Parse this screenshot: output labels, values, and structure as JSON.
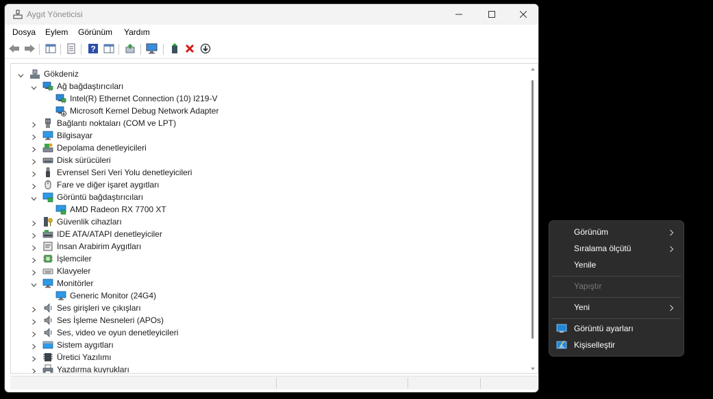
{
  "window": {
    "title": "Aygıt Yöneticisi",
    "controls": [
      "minimize-icon",
      "maximize-icon",
      "close-icon"
    ]
  },
  "menu": [
    "Dosya",
    "Eylem",
    "Görünüm",
    "Yardım"
  ],
  "toolbar_icons": [
    "back-arrow-icon",
    "forward-arrow-icon",
    "show-hide-console-tree-icon",
    "properties-icon",
    "help-icon",
    "show-action-pane-icon",
    "update-driver-icon",
    "scan-hardware-changes-icon",
    "enable-device-icon",
    "uninstall-device-icon",
    "disable-device-icon"
  ],
  "tree": {
    "root": "Gökdeniz",
    "items": [
      {
        "label": "Gökdeniz",
        "level": 0,
        "state": "expanded",
        "icon": "computer-root-icon"
      },
      {
        "label": "Ağ bağdaştırıcıları",
        "level": 1,
        "state": "expanded",
        "icon": "network-adapter-icon"
      },
      {
        "label": "Intel(R) Ethernet Connection (10) I219-V",
        "level": 2,
        "state": "leaf",
        "icon": "network-adapter-icon"
      },
      {
        "label": "Microsoft Kernel Debug Network Adapter",
        "level": 2,
        "state": "leaf",
        "icon": "network-adapter-disabled-icon"
      },
      {
        "label": "Bağlantı noktaları (COM ve LPT)",
        "level": 1,
        "state": "collapsed",
        "icon": "port-icon"
      },
      {
        "label": "Bilgisayar",
        "level": 1,
        "state": "collapsed",
        "icon": "monitor-icon"
      },
      {
        "label": "Depolama denetleyicileri",
        "level": 1,
        "state": "collapsed",
        "icon": "storage-controller-icon"
      },
      {
        "label": "Disk sürücüleri",
        "level": 1,
        "state": "collapsed",
        "icon": "disk-drive-icon"
      },
      {
        "label": "Evrensel Seri Veri Yolu denetleyicileri",
        "level": 1,
        "state": "collapsed",
        "icon": "usb-icon"
      },
      {
        "label": "Fare ve diğer işaret aygıtları",
        "level": 1,
        "state": "collapsed",
        "icon": "mouse-icon"
      },
      {
        "label": "Görüntü bağdaştırıcıları",
        "level": 1,
        "state": "expanded",
        "icon": "display-adapter-icon"
      },
      {
        "label": "AMD Radeon RX 7700 XT",
        "level": 2,
        "state": "leaf",
        "icon": "display-adapter-icon"
      },
      {
        "label": "Güvenlik cihazları",
        "level": 1,
        "state": "collapsed",
        "icon": "security-device-icon"
      },
      {
        "label": "IDE ATA/ATAPI denetleyiciler",
        "level": 1,
        "state": "collapsed",
        "icon": "ide-controller-icon"
      },
      {
        "label": "İnsan Arabirim Aygıtları",
        "level": 1,
        "state": "collapsed",
        "icon": "hid-icon"
      },
      {
        "label": "İşlemciler",
        "level": 1,
        "state": "collapsed",
        "icon": "processor-icon"
      },
      {
        "label": "Klavyeler",
        "level": 1,
        "state": "collapsed",
        "icon": "keyboard-icon"
      },
      {
        "label": "Monitörler",
        "level": 1,
        "state": "expanded",
        "icon": "monitor-icon"
      },
      {
        "label": "Generic Monitor (24G4)",
        "level": 2,
        "state": "leaf",
        "icon": "monitor-icon"
      },
      {
        "label": "Ses girişleri ve çıkışları",
        "level": 1,
        "state": "collapsed",
        "icon": "speaker-icon"
      },
      {
        "label": "Ses İşleme Nesneleri (APOs)",
        "level": 1,
        "state": "collapsed",
        "icon": "speaker-icon"
      },
      {
        "label": "Ses, video ve oyun denetleyicileri",
        "level": 1,
        "state": "collapsed",
        "icon": "speaker-icon"
      },
      {
        "label": "Sistem aygıtları",
        "level": 1,
        "state": "collapsed",
        "icon": "system-device-icon"
      },
      {
        "label": "Üretici Yazılımı",
        "level": 1,
        "state": "collapsed",
        "icon": "firmware-icon"
      },
      {
        "label": "Yazdırma kuyrukları",
        "level": 1,
        "state": "collapsed",
        "icon": "printer-icon"
      }
    ]
  },
  "context_menu": {
    "items": [
      {
        "label": "Görünüm",
        "submenu": true,
        "disabled": false,
        "icon": ""
      },
      {
        "label": "Sıralama ölçütü",
        "submenu": true,
        "disabled": false,
        "icon": ""
      },
      {
        "label": "Yenile",
        "submenu": false,
        "disabled": false,
        "icon": ""
      },
      {
        "label": "Yapıştır",
        "submenu": false,
        "disabled": true,
        "icon": ""
      },
      {
        "label": "Yeni",
        "submenu": true,
        "disabled": false,
        "icon": ""
      },
      {
        "label": "Görüntü ayarları",
        "submenu": false,
        "disabled": false,
        "icon": "display-settings-icon"
      },
      {
        "label": "Kişiselleştir",
        "submenu": false,
        "disabled": false,
        "icon": "personalize-icon"
      }
    ]
  },
  "colors": {
    "title_text": "#8a8a8a",
    "context_bg": "#2c2c2c",
    "context_text": "#ffffff",
    "context_disabled": "#7a7a7a",
    "accent_blue": "#1e88d8"
  }
}
